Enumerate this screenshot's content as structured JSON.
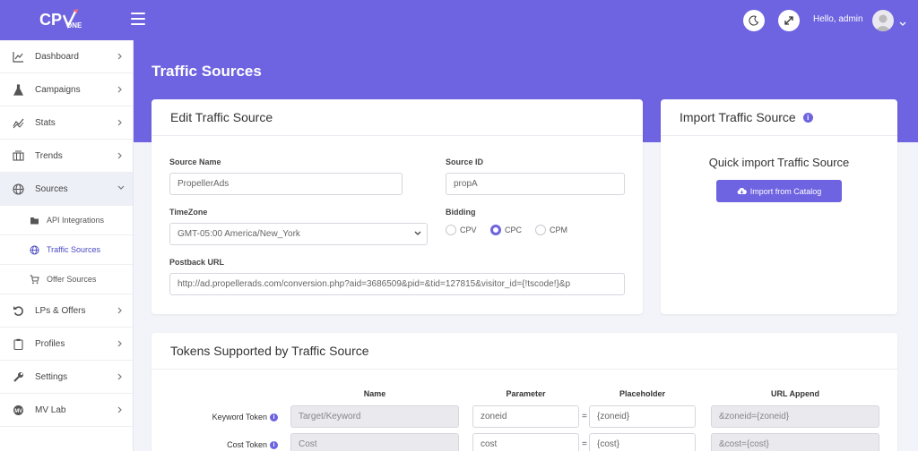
{
  "header": {
    "logo_text": "CPV",
    "logo_sub": "ONE",
    "greeting": "Hello, admin"
  },
  "sidebar": {
    "items": [
      {
        "label": "Dashboard",
        "icon": "chart-line-icon"
      },
      {
        "label": "Campaigns",
        "icon": "flask-icon"
      },
      {
        "label": "Stats",
        "icon": "stats-icon"
      },
      {
        "label": "Trends",
        "icon": "columns-icon"
      },
      {
        "label": "Sources",
        "icon": "globe-icon"
      }
    ],
    "sub_items": [
      {
        "label": "API Integrations",
        "icon": "folder-icon"
      },
      {
        "label": "Traffic Sources",
        "icon": "globe-icon"
      },
      {
        "label": "Offer Sources",
        "icon": "cart-icon"
      }
    ],
    "items_after": [
      {
        "label": "LPs & Offers",
        "icon": "undo-icon"
      },
      {
        "label": "Profiles",
        "icon": "clipboard-icon"
      },
      {
        "label": "Settings",
        "icon": "wrench-icon"
      },
      {
        "label": "MV Lab",
        "icon": "mvlab-icon"
      }
    ]
  },
  "page": {
    "title": "Traffic Sources"
  },
  "edit_card": {
    "title": "Edit Traffic Source",
    "source_name_label": "Source Name",
    "source_name_value": "PropellerAds",
    "source_id_label": "Source ID",
    "source_id_value": "propA",
    "timezone_label": "TimeZone",
    "timezone_value": "GMT-05:00 America/New_York",
    "bidding_label": "Bidding",
    "bidding_options": [
      "CPV",
      "CPC",
      "CPM"
    ],
    "bidding_selected": "CPC",
    "postback_label": "Postback URL",
    "postback_value": "http://ad.propellerads.com/conversion.php?aid=3686509&pid=&tid=127815&visitor_id={!tscode!}&p"
  },
  "import_card": {
    "title": "Import Traffic Source",
    "subtitle": "Quick import Traffic Source",
    "button_label": "Import from Catalog"
  },
  "tokens_card": {
    "title": "Tokens Supported by Traffic Source",
    "columns": [
      "Name",
      "Parameter",
      "Placeholder",
      "URL Append"
    ],
    "rows": [
      {
        "label": "Keyword Token",
        "name": "Target/Keyword",
        "parameter": "zoneid",
        "placeholder": "{zoneid}",
        "append": "&zoneid={zoneid}"
      },
      {
        "label": "Cost Token",
        "name": "Cost",
        "parameter": "cost",
        "placeholder": "{cost}",
        "append": "&cost={cost}"
      }
    ]
  },
  "colors": {
    "accent": "#6e63e0"
  }
}
